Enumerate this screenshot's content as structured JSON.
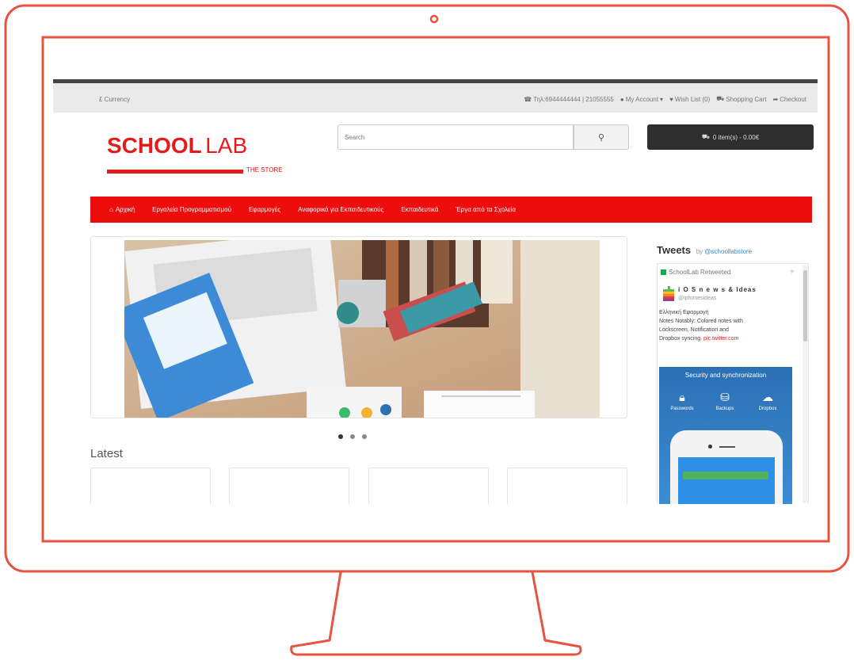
{
  "topbar": {
    "currency": "£ Currency",
    "links": [
      {
        "icon": "phone-icon",
        "label": "Τηλ:6944444444 | 21055555"
      },
      {
        "icon": "user-icon",
        "label": "My Account"
      },
      {
        "icon": "heart-icon",
        "label": "Wish List (0)"
      },
      {
        "icon": "cart-icon",
        "label": "Shopping Cart"
      },
      {
        "icon": "share-icon",
        "label": "Checkout"
      }
    ]
  },
  "logo": {
    "bold": "SCHOOL",
    "light": "LAB",
    "tagline": "THE STORE"
  },
  "search": {
    "placeholder": "Search"
  },
  "cart": {
    "label": "0 item(s) - 0.00€"
  },
  "nav": [
    {
      "label": "Αρχική",
      "icon": "home-icon"
    },
    {
      "label": "Εργαλεία Προγραμματισμού"
    },
    {
      "label": "Εφαρμογές"
    },
    {
      "label": "Αναφορικά για Εκπαιδευτικούς"
    },
    {
      "label": "Εκπαιδευτικά"
    },
    {
      "label": "Έργα από τα Σχολεία"
    }
  ],
  "slider": {
    "dots": 3,
    "active_dot": 0
  },
  "latest": {
    "title": "Latest"
  },
  "tweets": {
    "title": "Tweets",
    "by_prefix": "by",
    "by_handle": "@schoollabstore",
    "user": "SchoolLab Retweeted",
    "name": "i O S   n e w s   &   Ideas",
    "handle": "@iphonesideas",
    "text_line1": "Ελληνική Εφαρμογή",
    "text_line2": "Notes Notably: Colored notes with",
    "text_line3": "Lockscreen, Notification and",
    "text_line4": "Dropbox syncing.",
    "link": "pic.twitter.com",
    "ad_title": "Security and synchronization",
    "ad_features": [
      "Passwords",
      "Backups",
      "Dropbox"
    ]
  },
  "colors": {
    "brand_red": "#ee0d0d",
    "frame": "#e8533f",
    "dark": "#2e2e2e"
  }
}
